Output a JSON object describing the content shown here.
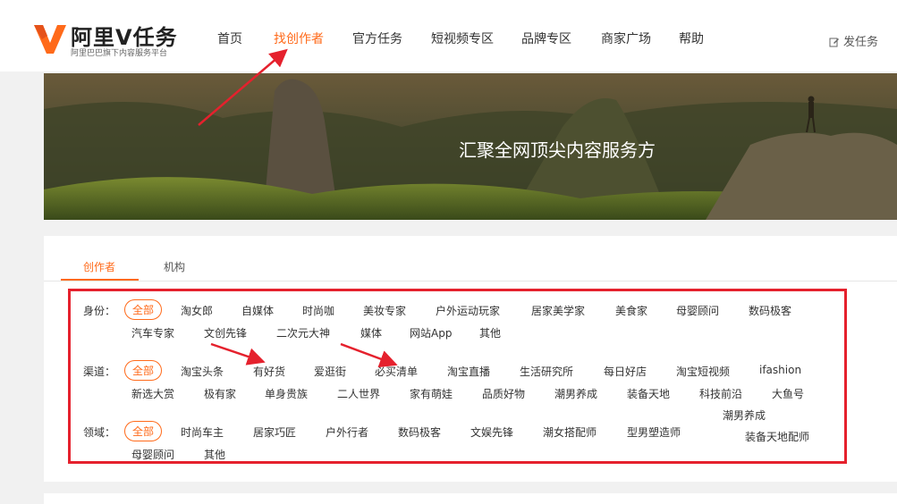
{
  "brand": {
    "title": "阿里V任务",
    "subtitle": "阿里巴巴旗下内容服务平台",
    "accent": "#ff6a1a"
  },
  "nav": {
    "items": [
      "首页",
      "找创作者",
      "官方任务",
      "短视频专区",
      "品牌专区",
      "商家广场",
      "帮助"
    ],
    "active": "找创作者",
    "publish": "发任务"
  },
  "banner": {
    "title": "汇聚全网顶尖内容服务方"
  },
  "tabs": {
    "items": [
      "创作者",
      "机构"
    ],
    "active": "创作者"
  },
  "filters": {
    "identity": {
      "label": "身份：",
      "options": [
        "全部",
        "淘女郎",
        "自媒体",
        "时尚咖",
        "美妆专家",
        "户外运动玩家",
        "居家美学家",
        "美食家",
        "母婴顾问",
        "数码极客",
        "汽车专家",
        "文创先锋",
        "二次元大神",
        "媒体",
        "网站App",
        "其他"
      ]
    },
    "channel": {
      "label": "渠道：",
      "options": [
        "全部",
        "淘宝头条",
        "有好货",
        "爱逛街",
        "必买清单",
        "淘宝直播",
        "生活研究所",
        "每日好店",
        "淘宝短视频",
        "ifashion",
        "新选大赏",
        "极有家",
        "单身贵族",
        "二人世界",
        "家有萌娃",
        "品质好物",
        "潮男养成",
        "装备天地",
        "科技前沿",
        "大鱼号"
      ]
    },
    "domain": {
      "label": "领域：",
      "options": [
        "全部",
        "时尚车主",
        "居家巧匠",
        "户外行者",
        "数码极客",
        "文娱先锋",
        "潮女搭配师",
        "型男塑造师",
        "潮男养成",
        "装备天地配师",
        "母婴顾问",
        "其他"
      ]
    }
  },
  "annotation_color": "#e5212d"
}
